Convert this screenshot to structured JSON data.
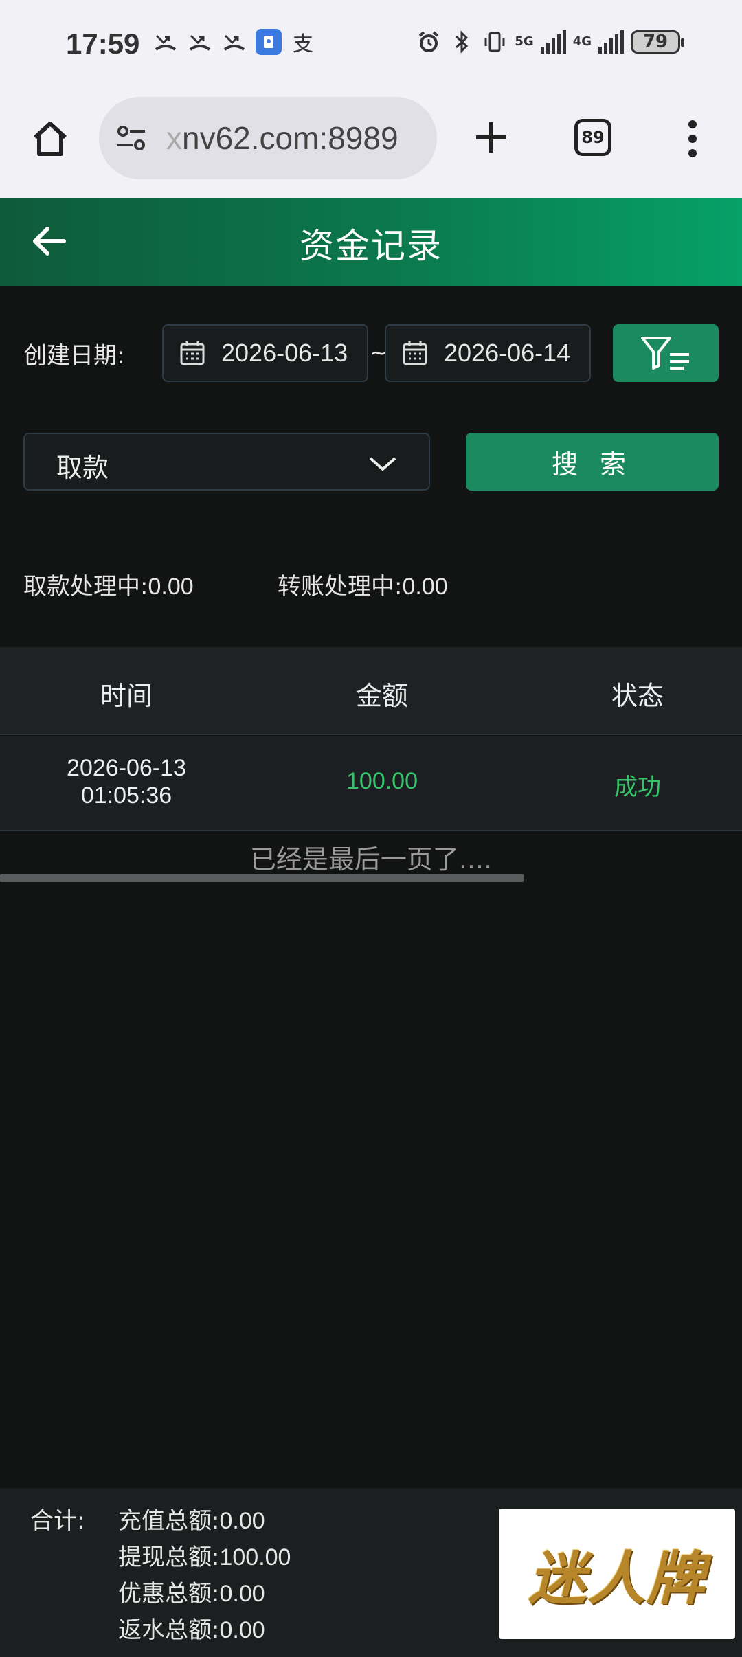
{
  "status_bar": {
    "time": "17:59",
    "net_5g": "5G",
    "net_4g": "4G",
    "battery": "79",
    "app_badge": "支"
  },
  "browser": {
    "url": "xnv62.com:8989",
    "url_fade": "x",
    "url_main": "nv62.com:8989",
    "tab_count": "89"
  },
  "header": {
    "title": "资金记录"
  },
  "filters": {
    "date_label": "创建日期:",
    "start_date": "2026-06-13",
    "date_separator": "~",
    "end_date": "2026-06-14",
    "type_selected": "取款",
    "search_label": "搜 索"
  },
  "summary": {
    "withdraw_label": "取款处理中:",
    "withdraw_value": "0.00",
    "transfer_label": "转账处理中:",
    "transfer_value": "0.00"
  },
  "table": {
    "columns": [
      "时间",
      "金额",
      "状态"
    ],
    "rows": [
      {
        "date": "2026-06-13",
        "time": "01:05:36",
        "amount": "100.00",
        "status": "成功"
      }
    ],
    "end_message": "已经是最后一页了...."
  },
  "totals": {
    "label": "合计:",
    "deposit_label": "充值总额:",
    "deposit_value": "0.00",
    "withdraw_label": "提现总额:",
    "withdraw_value": "100.00",
    "bonus_label": "优惠总额:",
    "bonus_value": "0.00",
    "rebate_label": "返水总额:",
    "rebate_value": "0.00"
  },
  "brand": {
    "text": "迷人牌"
  },
  "colors": {
    "accent": "#1c8a60",
    "success": "#35c46a",
    "header_gradient_start": "#0e5a3a",
    "header_gradient_end": "#06a168",
    "background": "#121413"
  }
}
